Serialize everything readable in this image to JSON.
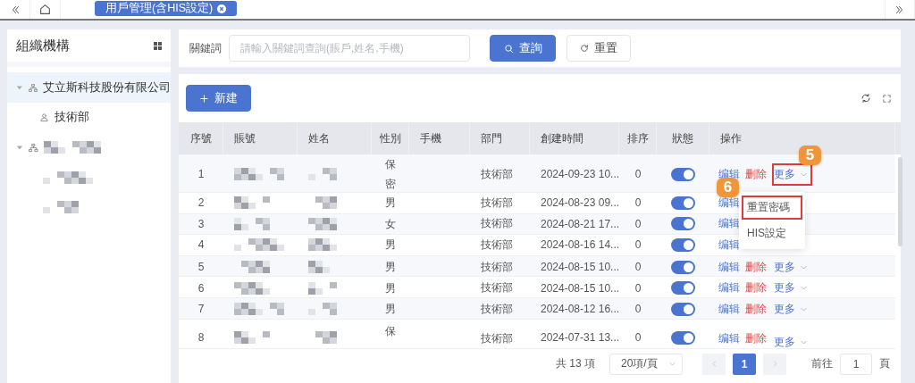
{
  "top_bar": {
    "tabs": [
      {
        "label": "用戶管理(含HIS設定)",
        "selected": true
      }
    ]
  },
  "sidebar": {
    "title": "組織機構",
    "tree": [
      {
        "label": "艾立斯科技股份有限公司",
        "expanded": true,
        "selected": true,
        "children": [
          {
            "label": "技術部",
            "selected": false
          }
        ]
      },
      {
        "kind": "redacted",
        "expanded": true,
        "selected": false,
        "children": [
          {
            "kind": "redacted",
            "selected": false
          },
          {
            "kind": "redacted",
            "selected": false
          }
        ]
      }
    ]
  },
  "search": {
    "label": "關鍵詞",
    "placeholder": "請輸入關鍵詞查詢(賬戶,姓名,手機)",
    "buttons": [
      {
        "kind": "primary",
        "label": "查詢"
      },
      {
        "kind": "default",
        "label": "重置"
      }
    ]
  },
  "toolbar": {
    "add_button": "新建"
  },
  "table": {
    "columns": [
      "序號",
      "賬號",
      "姓名",
      "性別",
      "手機",
      "部門",
      "創建時間",
      "排序",
      "狀態",
      "操作"
    ],
    "rows": [
      {
        "no": "1",
        "gender": "保密",
        "department": "技術部",
        "created": "2024-09-23 10...",
        "order": "0",
        "enabled": true,
        "actions": [
          {
            "kind": "edit",
            "label": "编辑"
          },
          {
            "kind": "delete",
            "label": "删除"
          },
          {
            "kind": "more",
            "label": "更多",
            "highlighted": true,
            "badge": "5",
            "open": true
          }
        ]
      },
      {
        "no": "2",
        "gender": "男",
        "department": "技術部",
        "created": "2024-08-23 09...",
        "order": "0",
        "enabled": true,
        "actions": [
          {
            "kind": "edit",
            "label": "编辑"
          }
        ]
      },
      {
        "no": "3",
        "gender": "女",
        "department": "技術部",
        "created": "2024-08-21 17...",
        "order": "0",
        "enabled": true,
        "actions": [
          {
            "kind": "edit",
            "label": "编辑"
          }
        ]
      },
      {
        "no": "4",
        "gender": "男",
        "department": "技術部",
        "created": "2024-08-16 14...",
        "order": "0",
        "enabled": true,
        "actions": [
          {
            "kind": "edit",
            "label": "编辑"
          }
        ]
      },
      {
        "no": "5",
        "gender": "男",
        "department": "技術部",
        "created": "2024-08-15 10...",
        "order": "0",
        "enabled": true,
        "actions": [
          {
            "kind": "edit",
            "label": "编辑"
          },
          {
            "kind": "delete",
            "label": "删除"
          },
          {
            "kind": "more",
            "label": "更多",
            "highlighted": false,
            "open": false
          }
        ]
      },
      {
        "no": "6",
        "gender": "男",
        "department": "技術部",
        "created": "2024-08-15 10...",
        "order": "0",
        "enabled": true,
        "actions": [
          {
            "kind": "edit",
            "label": "编辑"
          },
          {
            "kind": "delete",
            "label": "删除"
          },
          {
            "kind": "more",
            "label": "更多",
            "highlighted": false,
            "open": false
          }
        ]
      },
      {
        "no": "7",
        "gender": "男",
        "department": "技術部",
        "created": "2024-08-12 16...",
        "order": "0",
        "enabled": true,
        "actions": [
          {
            "kind": "edit",
            "label": "编辑"
          },
          {
            "kind": "delete",
            "label": "删除"
          },
          {
            "kind": "more",
            "label": "更多",
            "highlighted": false,
            "open": false
          }
        ]
      },
      {
        "no": "8",
        "gender": "保",
        "department": "技術部",
        "created": "2024-07-31 13...",
        "order": "0",
        "enabled": true,
        "actions": [
          {
            "kind": "edit",
            "label": "编辑"
          },
          {
            "kind": "delete",
            "label": "删除"
          },
          {
            "kind": "more",
            "label": "更多",
            "highlighted": false,
            "open": false
          }
        ]
      }
    ]
  },
  "dropdown": {
    "items": [
      {
        "label": "重置密碼",
        "highlighted": true,
        "badge": "6"
      },
      {
        "label": "HIS設定",
        "highlighted": false
      }
    ]
  },
  "pagination": {
    "total": "共 13 項",
    "page_size": "20項/頁",
    "pages": [
      {
        "label": "1",
        "selected": true
      }
    ],
    "goto_label": "前往",
    "goto_value": "1",
    "goto_suffix": "頁"
  }
}
